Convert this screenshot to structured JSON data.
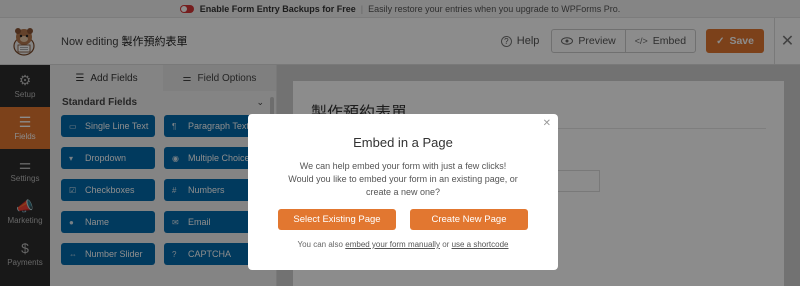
{
  "notice": {
    "title": "Enable Form Entry Backups for Free",
    "message": "Easily restore your entries when you upgrade to WPForms Pro."
  },
  "header": {
    "title_prefix": "Now editing",
    "form_name": "製作預約表單",
    "help_label": "Help",
    "preview_label": "Preview",
    "embed_label": "Embed",
    "save_label": "Save"
  },
  "nav": {
    "items": [
      {
        "label": "Setup",
        "icon": "gear-icon"
      },
      {
        "label": "Fields",
        "icon": "fields-icon"
      },
      {
        "label": "Settings",
        "icon": "sliders-icon"
      },
      {
        "label": "Marketing",
        "icon": "megaphone-icon"
      },
      {
        "label": "Payments",
        "icon": "dollar-icon"
      }
    ]
  },
  "panel": {
    "tabs": [
      "Add Fields",
      "Field Options"
    ],
    "section_title": "Standard Fields",
    "fields": [
      {
        "label": "Single Line Text",
        "icon": "text-icon"
      },
      {
        "label": "Paragraph Text",
        "icon": "paragraph-icon"
      },
      {
        "label": "Dropdown",
        "icon": "dropdown-icon"
      },
      {
        "label": "Multiple Choice",
        "icon": "radio-icon"
      },
      {
        "label": "Checkboxes",
        "icon": "checkbox-icon"
      },
      {
        "label": "Numbers",
        "icon": "hash-icon"
      },
      {
        "label": "Name",
        "icon": "user-icon"
      },
      {
        "label": "Email",
        "icon": "envelope-icon"
      },
      {
        "label": "Number Slider",
        "icon": "slider-icon"
      },
      {
        "label": "CAPTCHA",
        "icon": "captcha-icon"
      }
    ]
  },
  "preview": {
    "form_title": "製作預約表單"
  },
  "modal": {
    "title": "Embed in a Page",
    "line1": "We can help embed your form with just a few clicks!",
    "line2": "Would you like to embed your form in an existing page, or create a new one?",
    "select_label": "Select Existing Page",
    "create_label": "Create New Page",
    "foot_prefix": "You can also",
    "foot_link1": "embed your form manually",
    "foot_mid": "or",
    "foot_link2": "use a shortcode"
  },
  "colors": {
    "accent": "#e27730",
    "field_button": "#036aab",
    "nav_bg": "#2d2d2d"
  }
}
